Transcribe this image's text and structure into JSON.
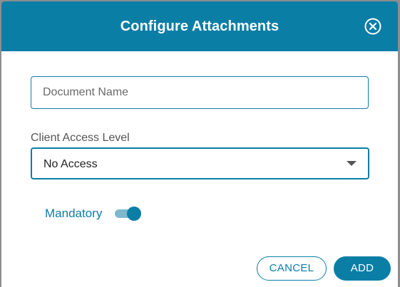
{
  "dialog": {
    "title": "Configure Attachments",
    "close_icon": "close-circle-icon"
  },
  "form": {
    "document_name": {
      "placeholder": "Document Name",
      "value": ""
    },
    "client_access_level": {
      "label": "Client Access Level",
      "selected": "No Access",
      "arrow_icon": "caret-down-icon"
    },
    "mandatory": {
      "label": "Mandatory",
      "on": true
    }
  },
  "actions": {
    "cancel_label": "CANCEL",
    "add_label": "ADD"
  },
  "colors": {
    "accent": "#0b7ea6",
    "toggle_track": "#7fb7cd",
    "backdrop": "#8e8e8e"
  }
}
